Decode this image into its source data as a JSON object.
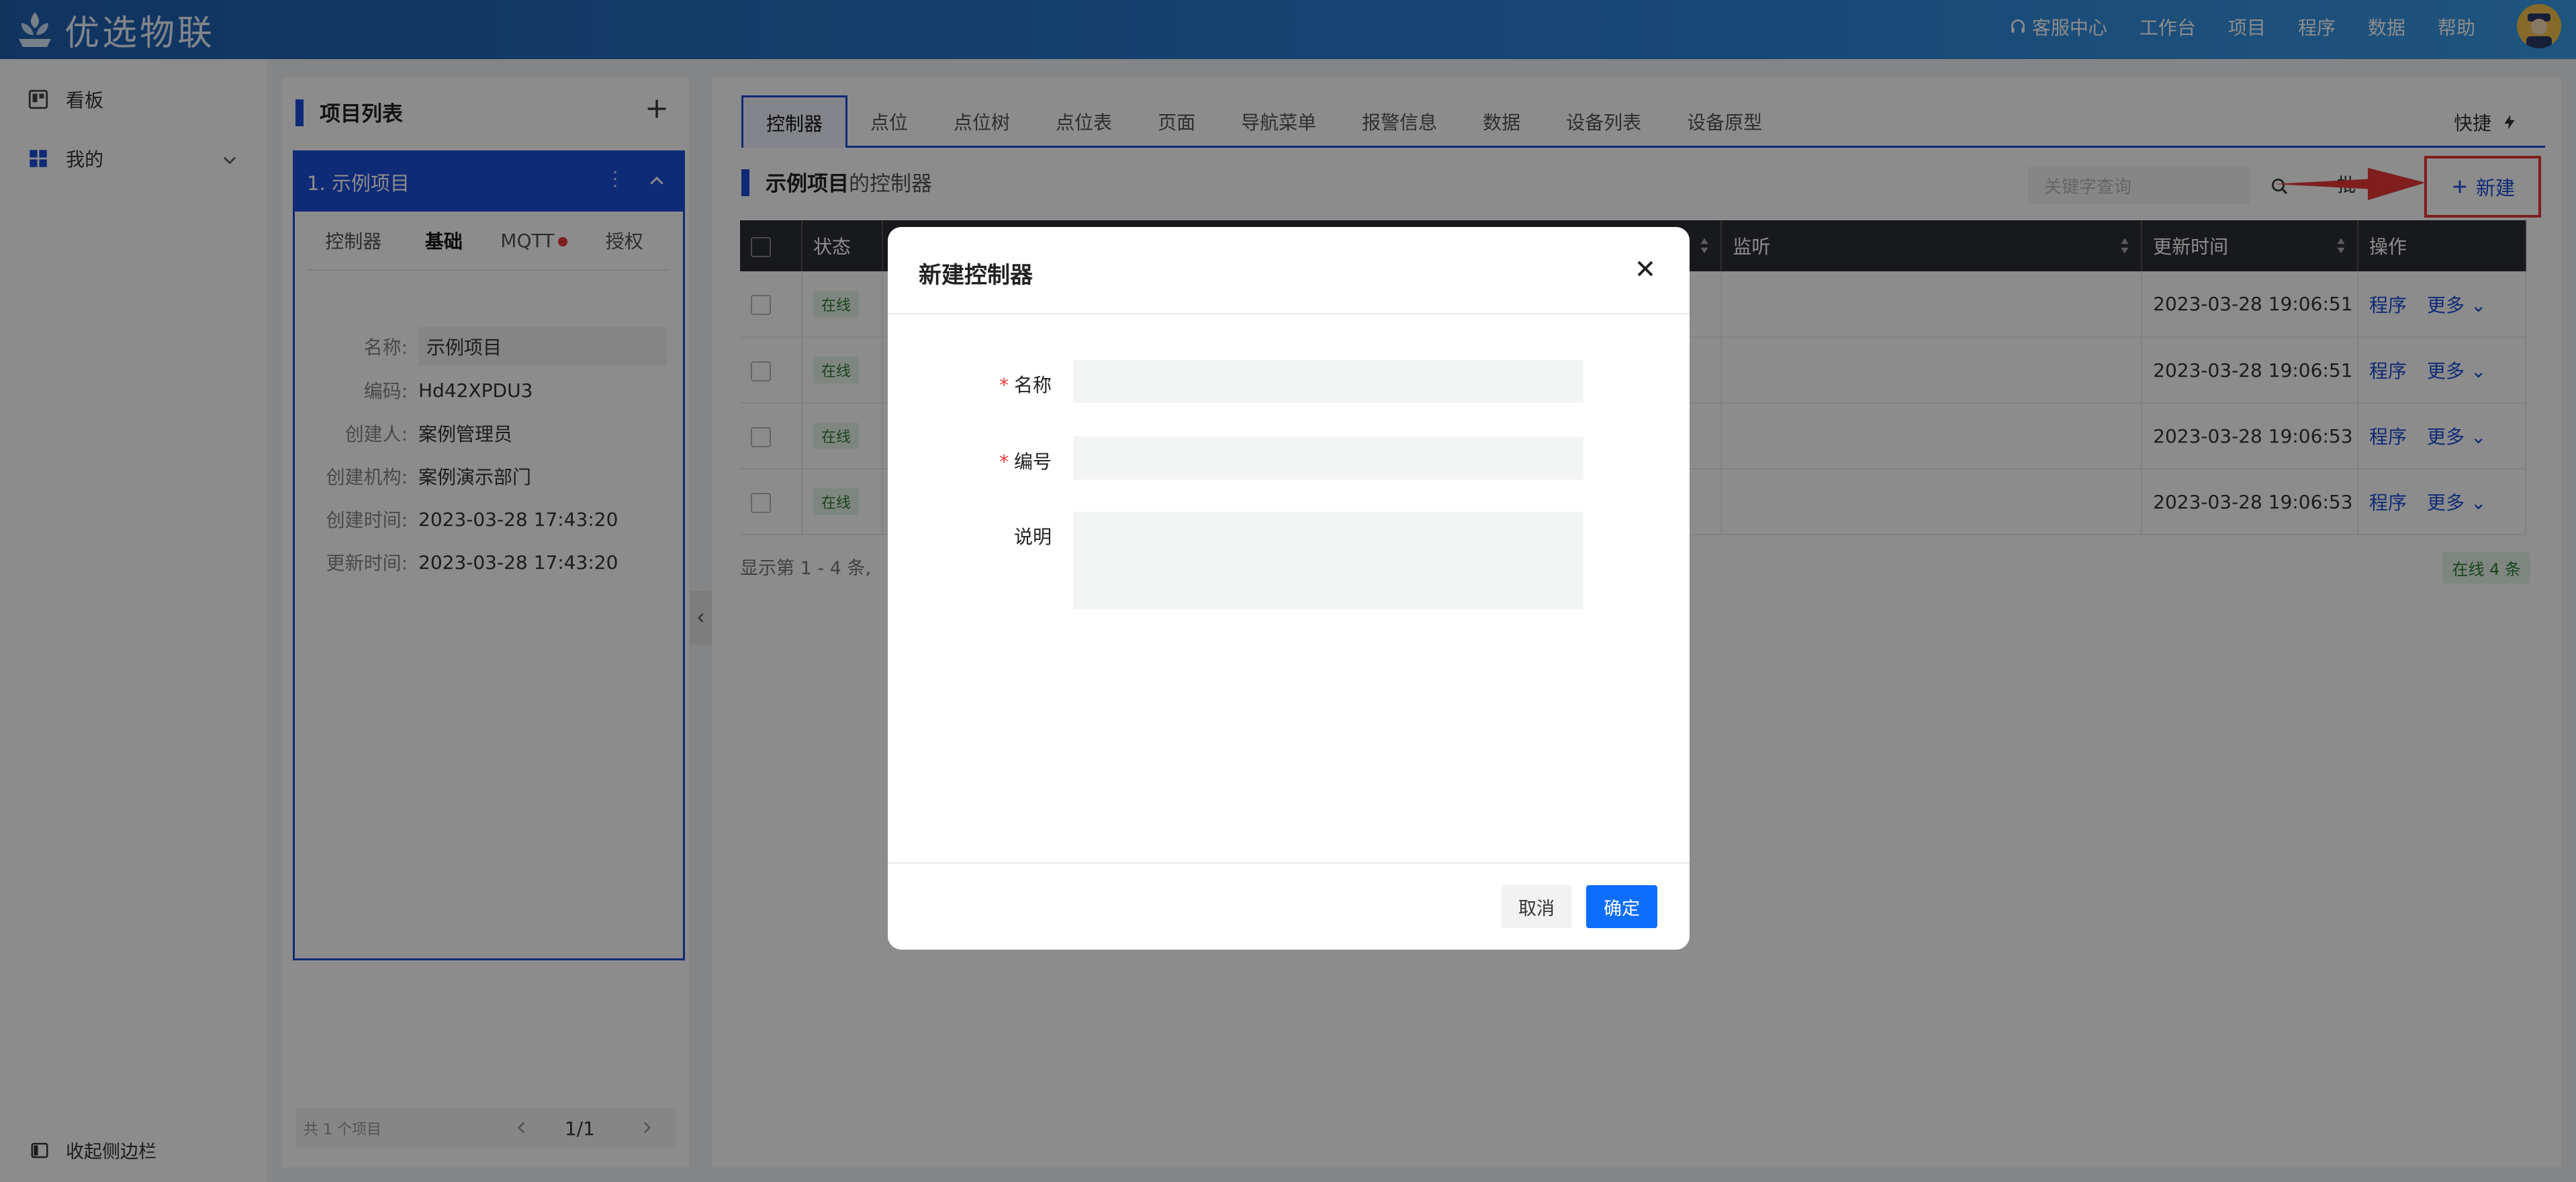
{
  "app": {
    "logo_text": "优选物联"
  },
  "topnav": {
    "service": "客服中心",
    "workbench": "工作台",
    "project": "项目",
    "program": "程序",
    "data": "数据",
    "help": "帮助"
  },
  "sidebar": {
    "dashboard": "看板",
    "mine": "我的",
    "collapse": "收起侧边栏"
  },
  "project_panel": {
    "title": "项目列表",
    "item_title": "1. 示例项目",
    "tabs": [
      "控制器",
      "基础",
      "MQTT",
      "授权"
    ],
    "active_tab": "基础",
    "info": {
      "name_label": "名称:",
      "name_value": "示例项目",
      "code_label": "编码:",
      "code_value": "Hd42XPDU3",
      "creator_label": "创建人:",
      "creator_value": "案例管理员",
      "org_label": "创建机构:",
      "org_value": "案例演示部门",
      "created_label": "创建时间:",
      "created_value": "2023-03-28 17:43:20",
      "updated_label": "更新时间:",
      "updated_value": "2023-03-28 17:43:20"
    },
    "pager": {
      "total": "共 1 个项目",
      "page": "1/1"
    }
  },
  "main": {
    "tabs": [
      "控制器",
      "点位",
      "点位树",
      "点位表",
      "页面",
      "导航菜单",
      "报警信息",
      "数据",
      "设备列表",
      "设备原型"
    ],
    "quick": "快捷",
    "section_title_strong": "示例项目",
    "section_title_rest": "的控制器",
    "search_placeholder": "关键字查询",
    "batch_label": "批",
    "new_label": "新建",
    "table": {
      "headers": {
        "status": "状态",
        "listen": "监听",
        "updated": "更新时间",
        "ops": "操作"
      },
      "rows": [
        {
          "status": "在线",
          "updated": "2023-03-28 19:06:51",
          "program": "程序",
          "more": "更多"
        },
        {
          "status": "在线",
          "updated": "2023-03-28 19:06:51",
          "program": "程序",
          "more": "更多"
        },
        {
          "status": "在线",
          "updated": "2023-03-28 19:06:53",
          "program": "程序",
          "more": "更多"
        },
        {
          "status": "在线",
          "updated": "2023-03-28 19:06:53",
          "program": "程序",
          "more": "更多"
        }
      ]
    },
    "footer_text": "显示第 1 - 4 条,",
    "online_tag": "在线 4 条"
  },
  "modal": {
    "title": "新建控制器",
    "name_label": "名称",
    "code_label": "编号",
    "desc_label": "说明",
    "name_value": "",
    "code_value": "",
    "desc_value": "",
    "cancel": "取消",
    "ok": "确定"
  },
  "colors": {
    "primary": "#1d4ed8",
    "confirm": "#0d6efd",
    "highlight": "#e53935"
  }
}
